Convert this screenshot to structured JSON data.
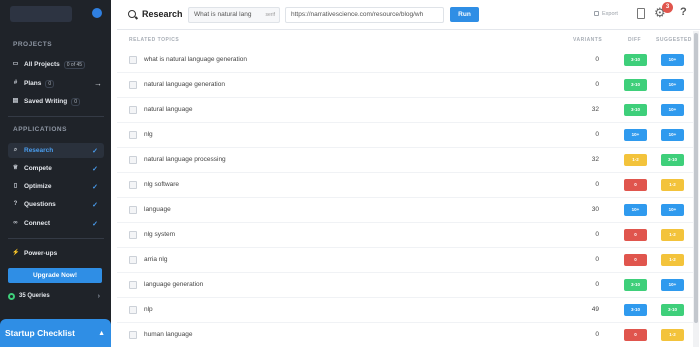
{
  "colors": {
    "sidebar_bg": "#1f2329",
    "accent": "#2f8ee5",
    "green": "#3ecf7a",
    "blue": "#2f9aee",
    "yellow": "#f3c33b",
    "red": "#e0554d"
  },
  "sidebar": {
    "section_projects": "PROJECTS",
    "all_projects": {
      "label": "All Projects",
      "badge": "0 of 45",
      "icon": "folder-icon"
    },
    "plans": {
      "label": "Plans",
      "badge": "0",
      "icon": "hash-icon"
    },
    "saved_writing": {
      "label": "Saved Writing",
      "badge": "0",
      "icon": "bookmark-icon"
    },
    "section_applications": "APPLICATIONS",
    "apps": [
      {
        "label": "Research",
        "icon": "search-icon",
        "active": true
      },
      {
        "label": "Compete",
        "icon": "trophy-icon",
        "active": false
      },
      {
        "label": "Optimize",
        "icon": "document-icon",
        "active": false
      },
      {
        "label": "Questions",
        "icon": "question-icon",
        "active": false
      },
      {
        "label": "Connect",
        "icon": "link-icon",
        "active": false
      }
    ],
    "powerups": {
      "label": "Power-ups",
      "icon": "bolt-icon"
    },
    "upgrade_label": "Upgrade Now!",
    "queries_label": "35 Queries",
    "checklist_label": "Startup Checklist"
  },
  "topbar": {
    "title": "Research",
    "query_value": "What is natural lang",
    "query_suffix": "serif",
    "url_value": "https://narrativescience.com/resource/blog/wh",
    "run_label": "Run",
    "export_label": "Export",
    "notif_count": "3",
    "help_label": "?"
  },
  "table": {
    "headers": {
      "topics": "RELATED TOPICS",
      "variants": "VARIANTS",
      "diff": "DIFF",
      "suggested": "SUGGESTED"
    },
    "rows": [
      {
        "topic": "what is natural language generation",
        "variants": "0",
        "diff": "3-10",
        "diff_color": "green",
        "sugg": "10+",
        "sugg_color": "blue"
      },
      {
        "topic": "natural language generation",
        "variants": "0",
        "diff": "3-10",
        "diff_color": "green",
        "sugg": "10+",
        "sugg_color": "blue"
      },
      {
        "topic": "natural language",
        "variants": "32",
        "diff": "3-10",
        "diff_color": "green",
        "sugg": "10+",
        "sugg_color": "blue"
      },
      {
        "topic": "nlg",
        "variants": "0",
        "diff": "10+",
        "diff_color": "blue",
        "sugg": "10+",
        "sugg_color": "blue"
      },
      {
        "topic": "natural language processing",
        "variants": "32",
        "diff": "1-2",
        "diff_color": "yellow",
        "sugg": "3-10",
        "sugg_color": "green"
      },
      {
        "topic": "nlg software",
        "variants": "0",
        "diff": "0",
        "diff_color": "red",
        "sugg": "1-2",
        "sugg_color": "yellow"
      },
      {
        "topic": "language",
        "variants": "30",
        "diff": "10+",
        "diff_color": "blue",
        "sugg": "10+",
        "sugg_color": "blue"
      },
      {
        "topic": "nlg system",
        "variants": "0",
        "diff": "0",
        "diff_color": "red",
        "sugg": "1-2",
        "sugg_color": "yellow"
      },
      {
        "topic": "arria nlg",
        "variants": "0",
        "diff": "0",
        "diff_color": "red",
        "sugg": "1-2",
        "sugg_color": "yellow"
      },
      {
        "topic": "language generation",
        "variants": "0",
        "diff": "3-10",
        "diff_color": "green",
        "sugg": "10+",
        "sugg_color": "blue"
      },
      {
        "topic": "nlp",
        "variants": "49",
        "diff": "3-10",
        "diff_color": "blue",
        "sugg": "3-10",
        "sugg_color": "green"
      },
      {
        "topic": "human language",
        "variants": "0",
        "diff": "0",
        "diff_color": "red",
        "sugg": "1-2",
        "sugg_color": "yellow"
      }
    ]
  }
}
